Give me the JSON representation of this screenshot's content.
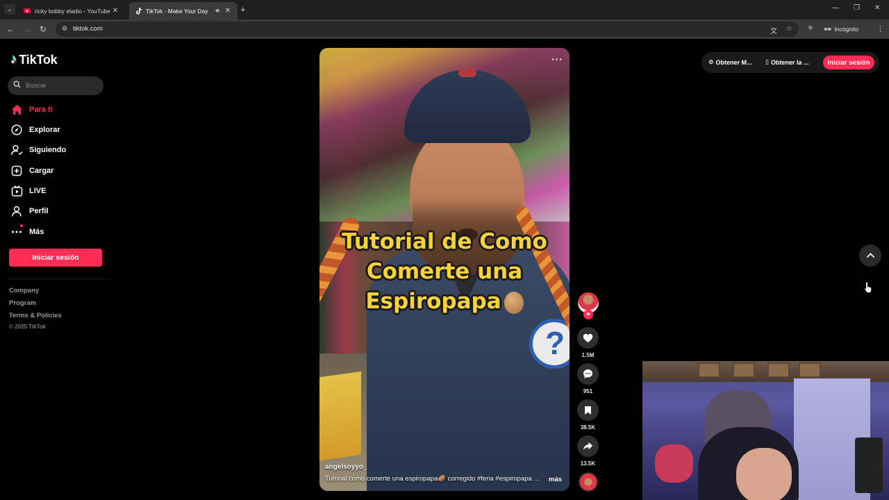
{
  "browser": {
    "tabs": [
      {
        "title": "ricky bobby eladio - YouTube",
        "icon": "youtube-icon",
        "active": false
      },
      {
        "title": "TikTok - Make Your Day",
        "icon": "tiktok-icon",
        "active": true
      }
    ],
    "url": "tiktok.com",
    "profile_label": "Incógnito"
  },
  "sidebar": {
    "logo_text": "TikTok",
    "search_placeholder": "Buscar",
    "nav": [
      {
        "label": "Para ti",
        "icon": "home-icon",
        "active": true
      },
      {
        "label": "Explorar",
        "icon": "compass-icon"
      },
      {
        "label": "Siguiendo",
        "icon": "following-icon"
      },
      {
        "label": "Cargar",
        "icon": "upload-icon"
      },
      {
        "label": "LIVE",
        "icon": "live-icon"
      },
      {
        "label": "Perfil",
        "icon": "profile-icon"
      },
      {
        "label": "Más",
        "icon": "more-icon"
      }
    ],
    "login_button": "Iniciar sesión",
    "footer_links": [
      "Company",
      "Program",
      "Terms & Policies"
    ],
    "copyright": "© 2025 TikTok"
  },
  "video": {
    "caption_lines": [
      "Tutorial de Como",
      "Comerte una",
      "Espiropapa"
    ],
    "author": "angelsoyyo_",
    "description": "Tutorial como comerte una espiropapa🥔 corregido #feria  #espiropapa ...",
    "more_label": "más"
  },
  "actions": {
    "likes": "1.5M",
    "comments": "951",
    "saves": "38.5K",
    "shares": "13.5K"
  },
  "topright": {
    "get_app_1": "Obtener M...",
    "get_app_2": "Obtener la ...",
    "login": "Iniciar sesión"
  },
  "colors": {
    "accent": "#fe2c55",
    "caption_yellow": "#f7d23a",
    "chrome_bg": "#1f1f1f",
    "page_bg": "#000000"
  }
}
